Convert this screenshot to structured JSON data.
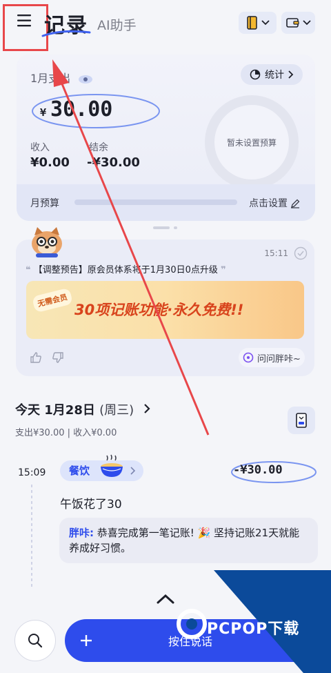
{
  "header": {
    "title": "记录",
    "tab_ai": "AI助手"
  },
  "summary": {
    "month_label": "1月支出",
    "currency": "¥",
    "expense": "30.00",
    "income_label": "收入",
    "income_value": "¥0.00",
    "balance_label": "结余",
    "balance_value": "-¥30.00",
    "stats_label": "统计",
    "budget_ring_text": "暂未设置预算",
    "budget_label": "月预算",
    "budget_action": "点击设置",
    "budget_progress": 0
  },
  "announcement": {
    "time": "15:11",
    "text": "【调整预告】原会员体系将于1月30日0点升级",
    "banner_badge": "无需会员",
    "banner_text": "30项记账功能·永久免费!!",
    "ask_label": "问问胖咔~"
  },
  "day": {
    "title": "今天 1月28日",
    "weekday": "(周三)",
    "summary": "支出¥30.00 | 收入¥0.00"
  },
  "record": {
    "time": "15:09",
    "category": "餐饮",
    "amount": "-¥30.00",
    "note": "午饭花了30",
    "reply_name": "胖咔:",
    "reply_text": "恭喜完成第一笔记账! 🎉 坚持记账21天就能养成好习惯。"
  },
  "bottom": {
    "voice_label": "按住说话"
  },
  "watermark": {
    "text": "PCPOP下载"
  },
  "colors": {
    "accent": "#2e4cec",
    "annotation_red": "#e8474a",
    "bg": "#f4f5f9"
  }
}
